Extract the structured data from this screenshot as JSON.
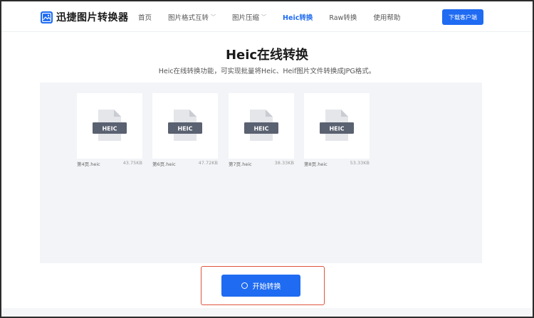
{
  "header": {
    "logo_text": "迅捷图片转换器",
    "nav": [
      {
        "label": "首页",
        "has_dropdown": false,
        "active": false
      },
      {
        "label": "图片格式互转",
        "has_dropdown": true,
        "active": false
      },
      {
        "label": "图片压缩",
        "has_dropdown": true,
        "active": false
      },
      {
        "label": "Heic转换",
        "has_dropdown": false,
        "active": true
      },
      {
        "label": "Raw转换",
        "has_dropdown": false,
        "active": false
      },
      {
        "label": "使用帮助",
        "has_dropdown": false,
        "active": false
      }
    ],
    "download_label": "下载客户端"
  },
  "main": {
    "title": "Heic在线转换",
    "subtitle": "Heic在线转换功能，可实现批量将Heic、Heif图片文件转换成JPG格式。",
    "files": [
      {
        "name": "第4页.heic",
        "size": "43.75KB",
        "badge": "HEIC"
      },
      {
        "name": "第6页.heic",
        "size": "47.72KB",
        "badge": "HEIC"
      },
      {
        "name": "第7页.heic",
        "size": "38.33KB",
        "badge": "HEIC"
      },
      {
        "name": "第8页.heic",
        "size": "53.33KB",
        "badge": "HEIC"
      }
    ],
    "start_button": "开始转换"
  },
  "colors": {
    "accent": "#1f6bf2",
    "highlight_outline": "#e0533d",
    "work_area_bg": "#f2f4f7",
    "file_icon_dark": "#5a6170",
    "file_icon_light": "#e4e6ea"
  }
}
